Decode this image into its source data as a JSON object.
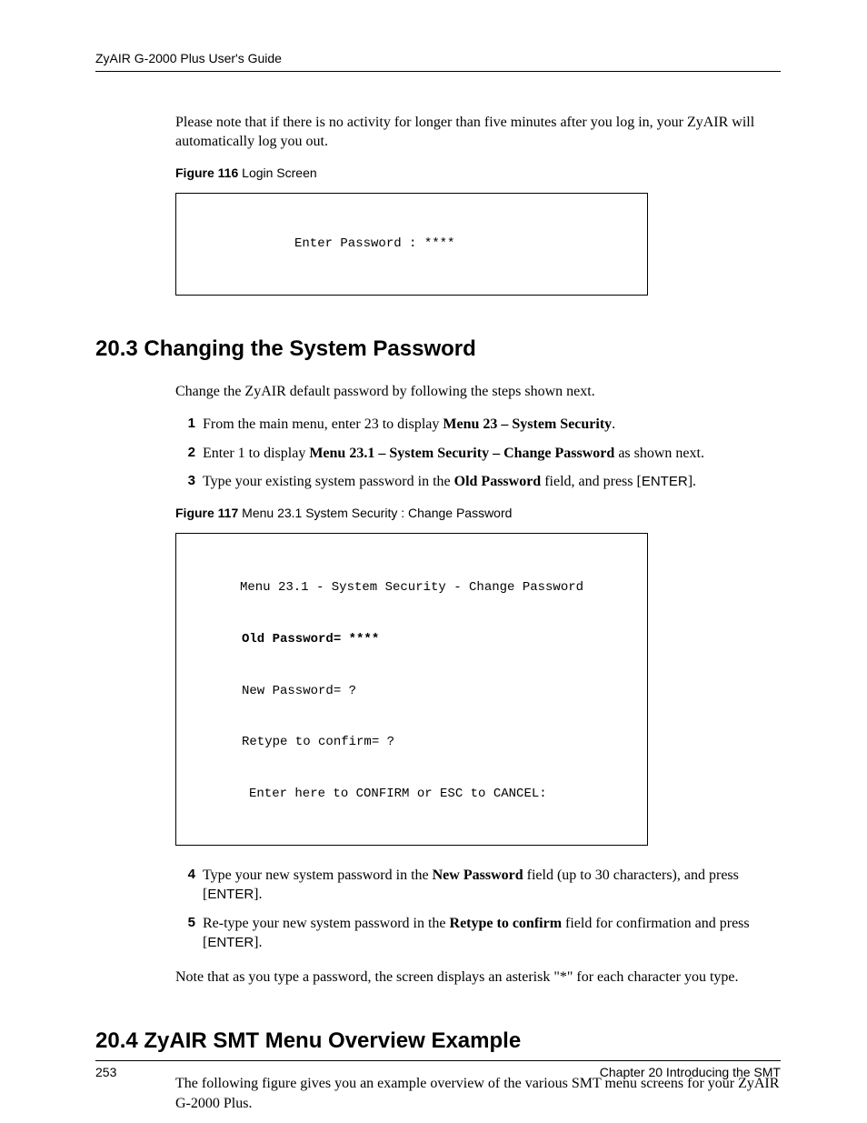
{
  "header": {
    "title": "ZyAIR G-2000 Plus User's Guide"
  },
  "intro": {
    "para1": "Please note that if there is no activity for longer than five minutes after you log in, your ZyAIR will automatically log you out."
  },
  "figure116": {
    "label_bold": "Figure 116",
    "label_rest": "   Login Screen",
    "line1": "Enter Password : ****"
  },
  "section203": {
    "heading": "20.3  Changing the System Password",
    "para1": "Change the ZyAIR default password by following the steps shown next.",
    "steps123": {
      "s1_num": "1",
      "s1_pre": "From the main menu, enter 23 to display ",
      "s1_bold": "Menu 23 – System Security",
      "s1_post": ".",
      "s2_num": "2",
      "s2_pre": "Enter 1 to display ",
      "s2_bold": "Menu 23.1 – System Security – Change Password",
      "s2_post": " as shown next.",
      "s3_num": "3",
      "s3_pre": "Type your existing system password in the ",
      "s3_bold": "Old Password",
      "s3_mid": " field, and press [",
      "s3_ss": "ENTER",
      "s3_end": "]."
    }
  },
  "figure117": {
    "label_bold": "Figure 117",
    "label_rest": "   Menu 23.1 System Security : Change Password",
    "line1": "Menu 23.1 - System Security - Change Password",
    "line2": "Old Password= ****",
    "line3": "New Password= ?",
    "line4": "Retype to confirm= ?",
    "line5": "Enter here to CONFIRM or ESC to CANCEL:"
  },
  "steps45": {
    "s4_num": "4",
    "s4_pre": "Type your new system password in the ",
    "s4_bold": "New Password",
    "s4_mid": " field (up to 30 characters), and press [",
    "s4_ss": "ENTER",
    "s4_end": "].",
    "s5_num": "5",
    "s5_pre": "Re-type your new system password in the ",
    "s5_bold": "Retype to confirm",
    "s5_mid": " field for confirmation and press [",
    "s5_ss": "ENTER",
    "s5_end": "]."
  },
  "section203_tail": {
    "para": "Note that as you type a password, the screen displays an asterisk \"*\" for each character you type."
  },
  "section204": {
    "heading": "20.4  ZyAIR SMT Menu Overview Example",
    "para1": "The following figure gives you an example overview of the various SMT menu screens for your ZyAIR G-2000 Plus."
  },
  "footer": {
    "page": "253",
    "chapter": "Chapter 20 Introducing the SMT"
  }
}
